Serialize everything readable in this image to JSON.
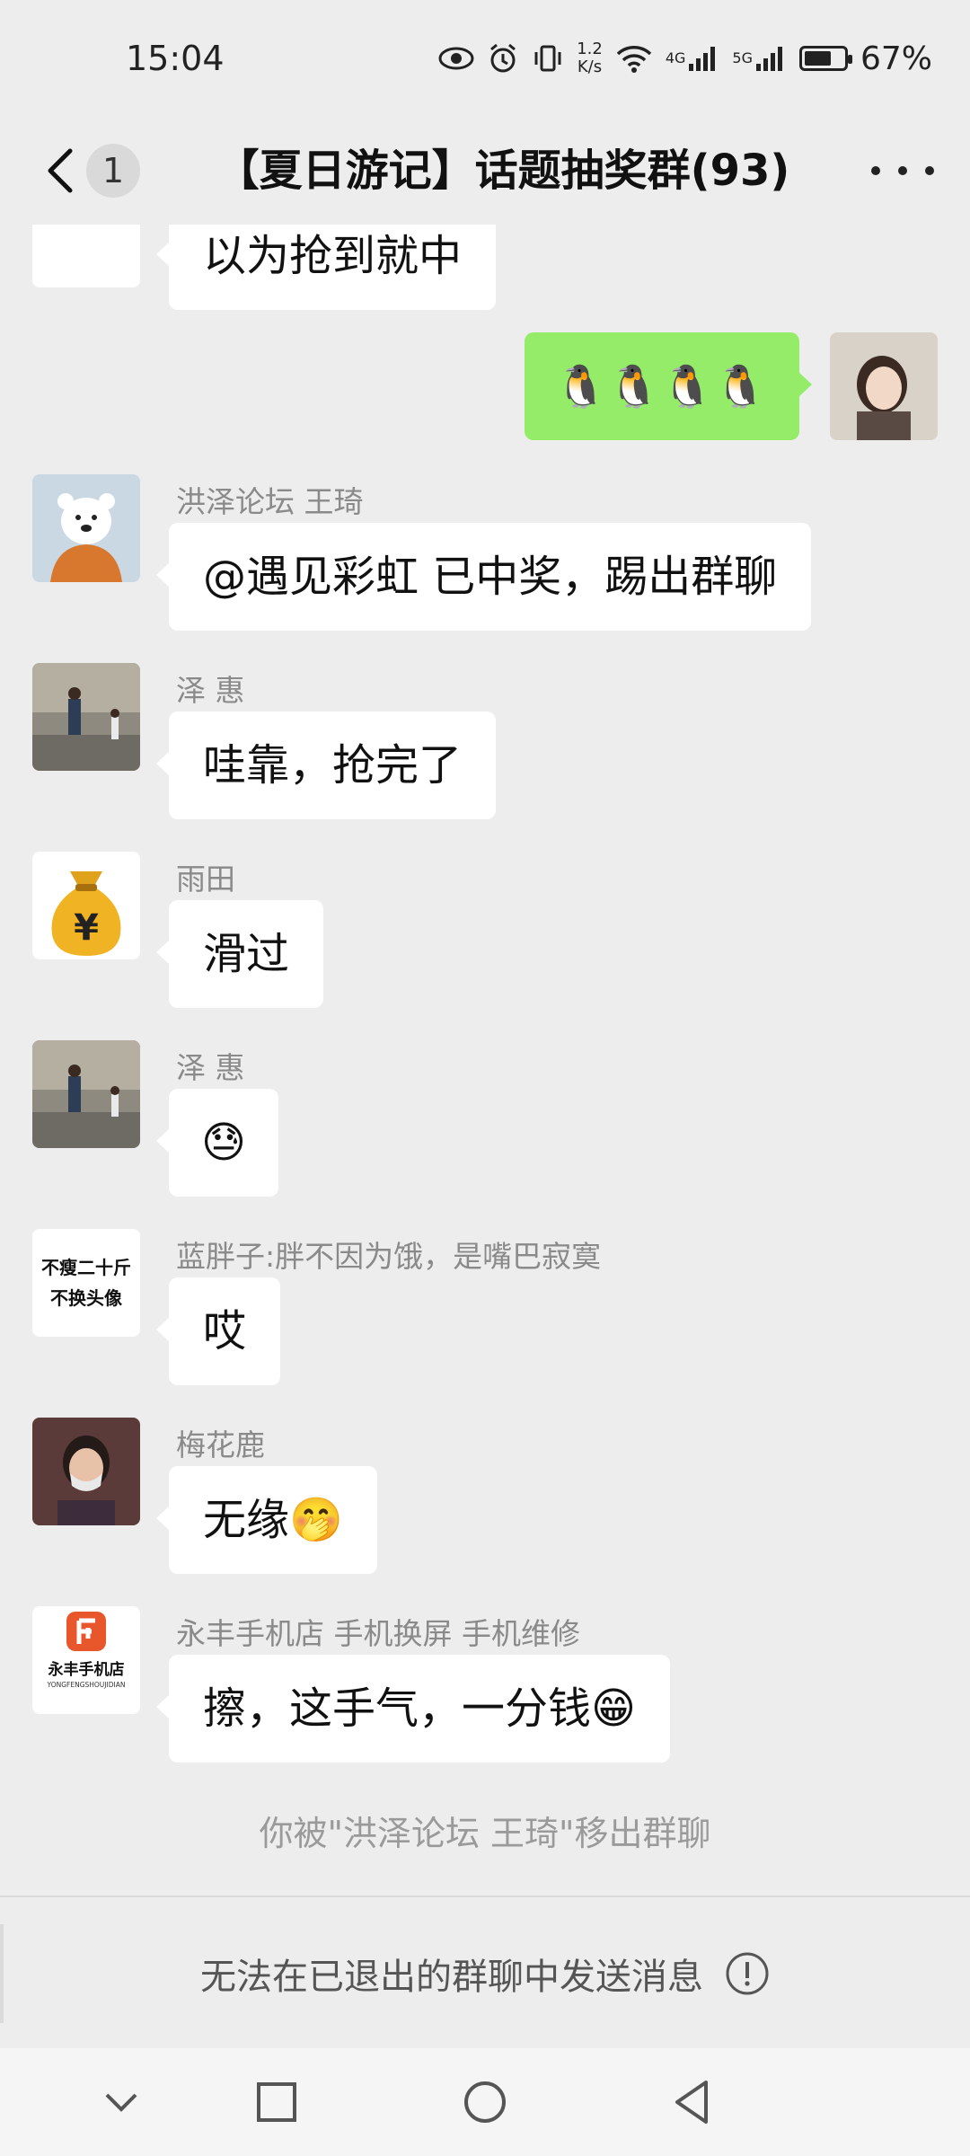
{
  "status_bar": {
    "time": "15:04",
    "speed_value": "1.2",
    "speed_unit": "K/s",
    "net1": "4G",
    "net2": "5G",
    "battery": "67%"
  },
  "header": {
    "unread_count": "1",
    "title": "【夏日游记】话题抽奖群(93)"
  },
  "messages": [
    {
      "sender": "",
      "text": "以为抢到就中",
      "avatar": "avatar-partial"
    },
    {
      "sender": "",
      "text": "🐧🐧🐧🐧",
      "self": true,
      "avatar": "self-avatar"
    },
    {
      "sender": "洪泽论坛 王琦",
      "text": "@遇见彩虹  已中奖，踢出群聊",
      "avatar": "polar-bear-avatar"
    },
    {
      "sender": "泽 惠",
      "text": "哇靠，抢完了",
      "avatar": "street-photo-avatar"
    },
    {
      "sender": "雨田",
      "text": "滑过",
      "avatar": "money-bag-avatar"
    },
    {
      "sender": "泽 惠",
      "text": "😓",
      "avatar": "street-photo-avatar"
    },
    {
      "sender": "蓝胖子:胖不因为饿，是嘴巴寂寞",
      "text": "哎",
      "avatar": "text-avatar",
      "avatar_text_1": "不瘦二十斤",
      "avatar_text_2": "不换头像"
    },
    {
      "sender": "梅花鹿",
      "text": "无缘🤭",
      "avatar": "masked-person-avatar"
    },
    {
      "sender": "永丰手机店 手机换屏 手机维修",
      "text": "擦，这手气，一分钱😁",
      "avatar": "phone-shop-logo-avatar",
      "avatar_text_1": "永丰手机店",
      "avatar_text_2": "YONGFENGSHOUJIDIAN"
    }
  ],
  "system_notice": "你被\"洪泽论坛 王琦\"移出群聊",
  "input_notice": "无法在已退出的群聊中发送消息",
  "colors": {
    "background": "#EDEDED",
    "self_bubble": "#95EC69",
    "other_bubble": "#FFFFFF"
  }
}
